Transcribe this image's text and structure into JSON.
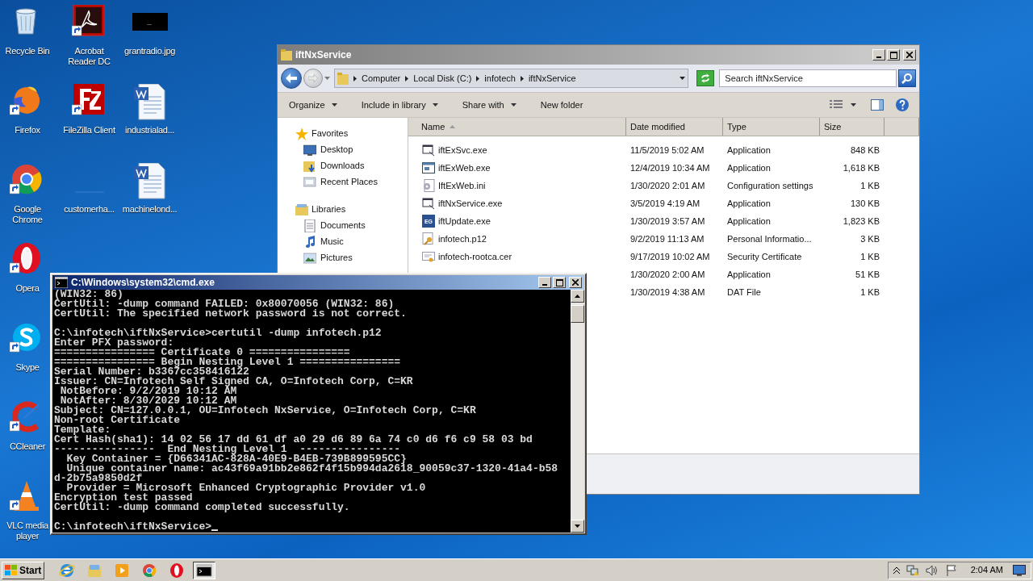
{
  "desktop": {
    "columns": [
      [
        {
          "label": "Recycle Bin",
          "kind": "recycle",
          "shortcut": false
        },
        {
          "label": "Firefox",
          "kind": "firefox",
          "shortcut": true
        },
        {
          "label": "Google Chrome",
          "kind": "chrome",
          "shortcut": true
        },
        {
          "label": "Opera",
          "kind": "opera",
          "shortcut": true
        },
        {
          "label": "Skype",
          "kind": "skype",
          "shortcut": true
        },
        {
          "label": "CCleaner",
          "kind": "ccleaner",
          "shortcut": true
        },
        {
          "label": "VLC media player",
          "kind": "vlc",
          "shortcut": true
        }
      ],
      [
        {
          "label": "Acrobat Reader DC",
          "kind": "acrobat",
          "shortcut": true
        },
        {
          "label": "FileZilla Client",
          "kind": "filezilla",
          "shortcut": true
        },
        {
          "label": "customerha...",
          "kind": "blank",
          "shortcut": false
        }
      ],
      [
        {
          "label": "grantradio.jpg",
          "kind": "image",
          "shortcut": false
        },
        {
          "label": "industrialad...",
          "kind": "word",
          "shortcut": false
        },
        {
          "label": "machinelond...",
          "kind": "word",
          "shortcut": false
        }
      ]
    ]
  },
  "explorer": {
    "title": "iftNxService",
    "active": false,
    "breadcrumbs": [
      "Computer",
      "Local Disk (C:)",
      "infotech",
      "iftNxService"
    ],
    "search": {
      "placeholder": "Search iftNxService"
    },
    "toolbar": [
      {
        "label": "Organize",
        "menu": true
      },
      {
        "label": "Include in library",
        "menu": true
      },
      {
        "label": "Share with",
        "menu": true
      },
      {
        "label": "New folder",
        "menu": false
      }
    ],
    "nav": [
      {
        "label": "Favorites",
        "kind": "star",
        "children": [
          {
            "label": "Desktop",
            "kind": "monitor"
          },
          {
            "label": "Downloads",
            "kind": "downloads"
          },
          {
            "label": "Recent Places",
            "kind": "places"
          }
        ]
      },
      {
        "label": "Libraries",
        "kind": "library",
        "children": [
          {
            "label": "Documents",
            "kind": "document"
          },
          {
            "label": "Music",
            "kind": "music"
          },
          {
            "label": "Pictures",
            "kind": "pictures"
          }
        ]
      }
    ],
    "columns": [
      "Name",
      "Date modified",
      "Type",
      "Size"
    ],
    "rows": [
      {
        "name": "iftExSvc.exe",
        "kind": "window",
        "date": "11/5/2019 5:02 AM",
        "type": "Application",
        "size": "848 KB"
      },
      {
        "name": "iftExWeb.exe",
        "kind": "app",
        "date": "12/4/2019 10:34 AM",
        "type": "Application",
        "size": "1,618 KB"
      },
      {
        "name": "IftExWeb.ini",
        "kind": "settings",
        "date": "1/30/2020 2:01 AM",
        "type": "Configuration settings",
        "size": "1 KB"
      },
      {
        "name": "iftNxService.exe",
        "kind": "window",
        "date": "3/5/2019 4:19 AM",
        "type": "Application",
        "size": "130 KB"
      },
      {
        "name": "iftUpdate.exe",
        "kind": "badge",
        "badge": "EG",
        "date": "1/30/2019 3:57 AM",
        "type": "Application",
        "size": "1,823 KB"
      },
      {
        "name": "infotech.p12",
        "kind": "key",
        "date": "9/2/2019 11:13 AM",
        "type": "Personal Informatio...",
        "size": "3 KB"
      },
      {
        "name": "infotech-rootca.cer",
        "kind": "cert",
        "date": "9/17/2019 10:02 AM",
        "type": "Security Certificate",
        "size": "1 KB"
      },
      {
        "date": "1/30/2020 2:00 AM",
        "type": "Application",
        "size": "51 KB"
      },
      {
        "date": "1/30/2019 4:38 AM",
        "type": "DAT File",
        "size": "1 KB"
      }
    ]
  },
  "console": {
    "title": "C:\\Windows\\system32\\cmd.exe",
    "active": true,
    "blocks": [
      [
        "(WIN32: 86)",
        "CertUtil: -dump command FAILED: 0x80070056 (WIN32: 86)",
        "CertUtil: The specified network password is not correct."
      ],
      [
        "C:\\infotech\\iftNxService>certutil -dump infotech.p12",
        "Enter PFX password:",
        "================ Certificate 0 ================",
        "================ Begin Nesting Level 1 ================",
        "Serial Number: b3367cc358416122",
        "Issuer: CN=Infotech Self Signed CA, O=Infotech Corp, C=KR",
        " NotBefore: 9/2/2019 10:12 AM",
        " NotAfter: 8/30/2029 10:12 AM",
        "Subject: CN=127.0.0.1, OU=Infotech NxService, O=Infotech Corp, C=KR",
        "Non-root Certificate",
        "Template:",
        "Cert Hash(sha1): 14 02 56 17 dd 61 df a0 29 d6 89 6a 74 c0 d6 f6 c9 58 03 bd",
        "----------------  End Nesting Level 1  ----------------",
        "  Key Container = {D66341AC-828A-40E9-B4EB-739B899595CC}",
        "  Unique container name: ac43f69a91bb2e862f4f15b994da2618_90059c37-1320-41a4-b58",
        "d-2b75a9850d2f",
        "  Provider = Microsoft Enhanced Cryptographic Provider v1.0",
        "Encryption test passed",
        "CertUtil: -dump command completed successfully."
      ],
      [
        "C:\\infotech\\iftNxService>"
      ]
    ],
    "cursor": true
  },
  "taskbar": {
    "start": "Start",
    "items": [
      {
        "kind": "ie",
        "selected": false
      },
      {
        "kind": "folder",
        "selected": false
      },
      {
        "kind": "media",
        "selected": false
      },
      {
        "kind": "chrome",
        "selected": false
      },
      {
        "kind": "opera",
        "selected": false
      },
      {
        "kind": "console",
        "selected": true
      }
    ],
    "clock": "2:04 AM"
  }
}
